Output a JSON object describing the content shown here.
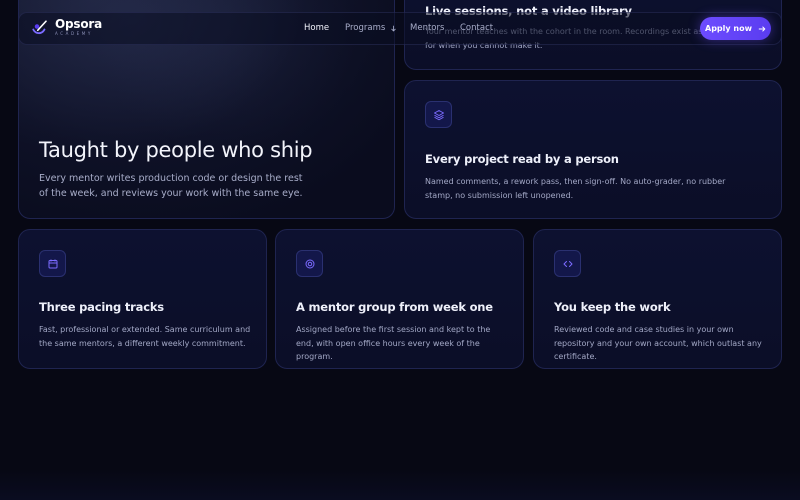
{
  "nav": {
    "logo_name": "Opsora",
    "logo_sub": "ACADEMY",
    "links": [
      "Home",
      "Programs",
      "Mentors",
      "Contact"
    ],
    "cta": "Apply now"
  },
  "hero": {
    "title": "Taught by people who ship",
    "text": "Every mentor writes production code or design the rest of the week, and reviews your work with the same eye."
  },
  "cards": {
    "live": {
      "title": "Live sessions, not a video library",
      "text": "Your mentor teaches with the cohort in the room. Recordings exist as a backup for when you cannot make it."
    },
    "project": {
      "icon": "layers-icon",
      "title": "Every project read by a person",
      "text": "Named comments, a rework pass, then sign-off. No auto-grader, no rubber stamp, no submission left unopened."
    },
    "pace": {
      "icon": "calendar-icon",
      "title": "Three pacing tracks",
      "text": "Fast, professional or extended. Same curriculum and the same mentors, a different weekly commitment."
    },
    "mentor": {
      "icon": "target-icon",
      "title": "A mentor group from week one",
      "text": "Assigned before the first session and kept to the end, with open office hours every week of the program."
    },
    "keep": {
      "icon": "code-icon",
      "title": "You keep the work",
      "text": "Reviewed code and case studies in your own repository and your own account, which outlast any certificate."
    }
  },
  "colors": {
    "background": "#070814",
    "accent": "#6d4cff",
    "card_border": "#1f2450",
    "icon_stroke": "#7b6bff"
  }
}
